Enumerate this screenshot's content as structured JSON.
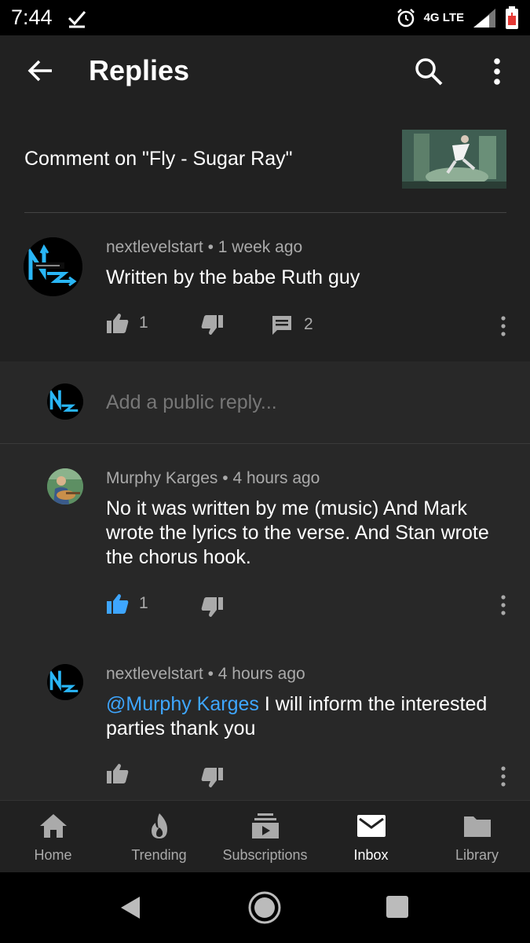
{
  "status_bar": {
    "time": "7:44",
    "network": "4G LTE"
  },
  "app_bar": {
    "title": "Replies"
  },
  "header": {
    "comment_on": "Comment on \"Fly - Sugar Ray\""
  },
  "main_comment": {
    "author": "nextlevelstart",
    "age": "1 week ago",
    "text": "Written by the babe Ruth guy",
    "likes": "1",
    "replies": "2"
  },
  "reply_input": {
    "placeholder": "Add a public reply..."
  },
  "replies": [
    {
      "author": "Murphy Karges",
      "age": "4 hours ago",
      "text": "No it was written by me (music) And Mark wrote the lyrics to the verse. And Stan wrote the chorus hook.",
      "likes": "1",
      "liked": true
    },
    {
      "author": "nextlevelstart",
      "age": "4 hours ago",
      "mention": "@Murphy Karges",
      "text": " I will inform the interested parties thank you",
      "likes": "",
      "liked": false
    }
  ],
  "bottom_nav": [
    {
      "label": "Home",
      "icon": "home-icon"
    },
    {
      "label": "Trending",
      "icon": "flame-icon"
    },
    {
      "label": "Subscriptions",
      "icon": "subscriptions-icon"
    },
    {
      "label": "Inbox",
      "icon": "mail-icon",
      "active": true
    },
    {
      "label": "Library",
      "icon": "folder-icon"
    }
  ],
  "colors": {
    "accent_blue": "#3ea6ff",
    "background": "#282828",
    "surface": "#212121"
  }
}
